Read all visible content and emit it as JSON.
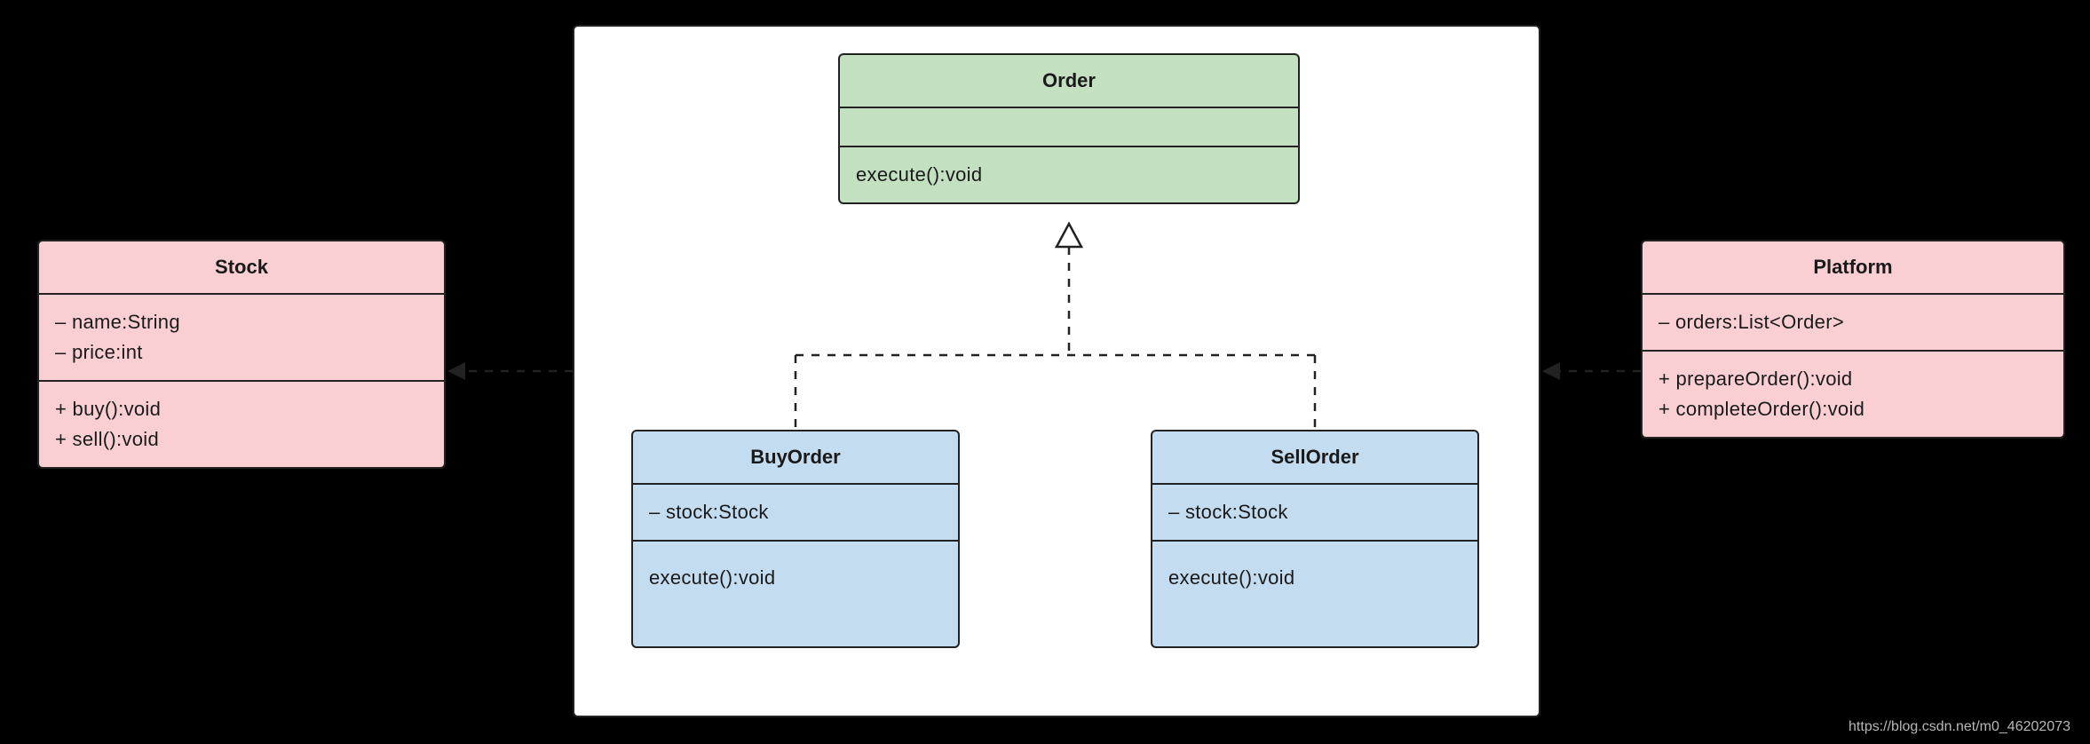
{
  "watermark": "https://blog.csdn.net/m0_46202073",
  "classes": {
    "stock": {
      "name": "Stock",
      "attrs": [
        "– name:String",
        "– price:int"
      ],
      "methods": [
        "+ buy():void",
        "+ sell():void"
      ]
    },
    "order": {
      "name": "Order",
      "attrs": [],
      "methods": [
        "execute():void"
      ]
    },
    "buyOrder": {
      "name": "BuyOrder",
      "attrs": [
        "– stock:Stock"
      ],
      "methods": [
        "execute():void"
      ]
    },
    "sellOrder": {
      "name": "SellOrder",
      "attrs": [
        "– stock:Stock"
      ],
      "methods": [
        "execute():void"
      ]
    },
    "platform": {
      "name": "Platform",
      "attrs": [
        "– orders:List<Order>"
      ],
      "methods": [
        "+ prepareOrder():void",
        "+ completeOrder():void"
      ]
    }
  },
  "relations": [
    {
      "from": "BuyOrder",
      "to": "Order",
      "type": "realization"
    },
    {
      "from": "SellOrder",
      "to": "Order",
      "type": "realization"
    },
    {
      "from": "container",
      "to": "Stock",
      "type": "dependency"
    },
    {
      "from": "container",
      "to": "Platform",
      "type": "dependency"
    }
  ]
}
